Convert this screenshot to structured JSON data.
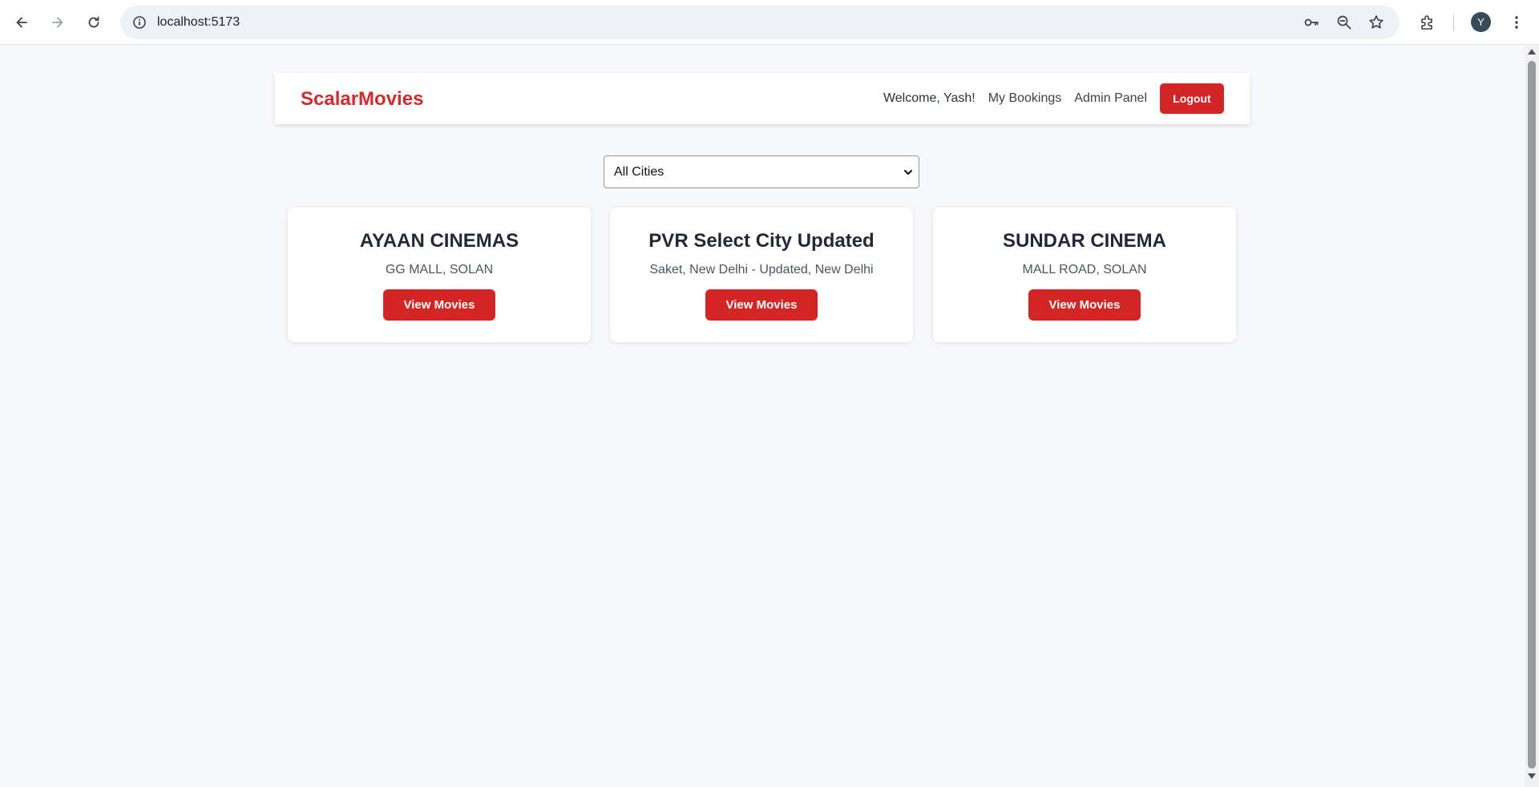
{
  "browser": {
    "url": "localhost:5173",
    "profile_initial": "Y",
    "icons": [
      "back-icon",
      "forward-icon",
      "reload-icon",
      "site-info-icon",
      "key-icon",
      "zoom-icon",
      "star-icon",
      "extensions-icon",
      "menu-icon"
    ]
  },
  "header": {
    "brand": "ScalarMovies",
    "welcome": "Welcome, Yash!",
    "my_bookings": "My Bookings",
    "admin_panel": "Admin Panel",
    "logout": "Logout"
  },
  "filter": {
    "selected_city": "All Cities"
  },
  "theatres": [
    {
      "name": "AYAAN CINEMAS",
      "location": "GG MALL, SOLAN",
      "button": "View Movies"
    },
    {
      "name": "PVR Select City Updated",
      "location": "Saket, New Delhi - Updated, New Delhi",
      "button": "View Movies"
    },
    {
      "name": "SUNDAR CINEMA",
      "location": "MALL ROAD, SOLAN",
      "button": "View Movies"
    }
  ],
  "colors": {
    "brand": "#d32a2a",
    "button": "#d42525",
    "background": "#f6f8fb"
  }
}
